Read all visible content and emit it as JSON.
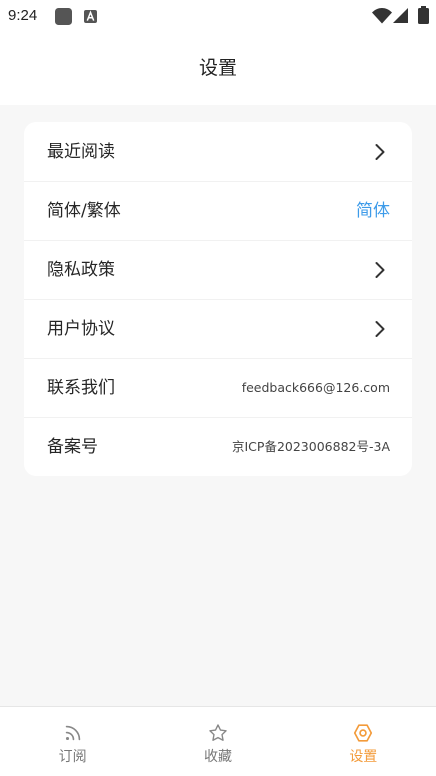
{
  "status_bar": {
    "time": "9:24",
    "left_icons": [
      "notification-square-icon",
      "a-app-icon"
    ],
    "right_icons": [
      "wifi-icon",
      "signal-icon",
      "battery-icon"
    ]
  },
  "header": {
    "title": "设置"
  },
  "settings": {
    "rows": [
      {
        "label": "最近阅读",
        "trailing_icon": "chevron-right-icon"
      },
      {
        "label": "简体/繁体",
        "value": "简体"
      },
      {
        "label": "隐私政策",
        "trailing_icon": "chevron-right-icon"
      },
      {
        "label": "用户协议",
        "trailing_icon": "chevron-right-icon"
      },
      {
        "label": "联系我们",
        "value": "feedback666@126.com"
      },
      {
        "label": "备案号",
        "value": "京ICP备2023006882号-3A"
      }
    ]
  },
  "tab_bar": {
    "tabs": [
      {
        "label": "订阅",
        "icon": "rss-icon",
        "active": false
      },
      {
        "label": "收藏",
        "icon": "star-icon",
        "active": false
      },
      {
        "label": "设置",
        "icon": "settings-hexagon-icon",
        "active": true
      }
    ]
  },
  "colors": {
    "accent": "#F39B3A",
    "link": "#3D9BE9",
    "background": "#F7F7F7",
    "inactive_tab": "#777777"
  }
}
